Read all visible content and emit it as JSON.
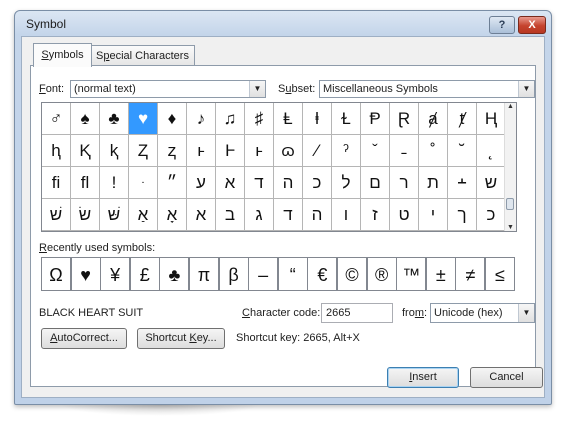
{
  "window": {
    "title": "Symbol",
    "help_label": "?",
    "close_label": "X"
  },
  "tabs": [
    {
      "label": "Symbols",
      "mnemonic": "S",
      "rest": "ymbols"
    },
    {
      "label": "Special Characters",
      "pre": "S",
      "mnemonic": "p",
      "rest": "ecial Characters"
    }
  ],
  "font": {
    "label_m": "F",
    "label_rest": "ont:",
    "value": "(normal text)"
  },
  "subset": {
    "label_pre": "S",
    "label_m": "u",
    "label_rest": "bset:",
    "value": "Miscellaneous Symbols"
  },
  "symbol_grid": {
    "rows": [
      [
        "♂",
        "♠",
        "♣",
        "♥",
        "♦",
        "♪",
        "♫",
        "♯",
        "Ⱡ",
        "ⱡ",
        "Ɫ",
        "Ᵽ",
        "Ɽ",
        "ⱥ",
        "ⱦ",
        "Ⱨ"
      ],
      [
        "ⱨ",
        "Ⱪ",
        "ⱪ",
        "Ⱬ",
        "ⱬ",
        "ⱶ",
        "Ⱶ",
        "ⱶ",
        "ɷ",
        "⁄",
        "ˀ",
        "ˇ",
        "˗",
        "˚",
        "˘",
        "˛"
      ],
      [
        "ﬁ",
        "ﬂ",
        "!",
        "ּ",
        "״",
        "ע",
        "א",
        "ד",
        "ה",
        "כ",
        "ל",
        "ם",
        "ר",
        "ת",
        "﬩",
        "ש"
      ],
      [
        "שׁ",
        "שׂ",
        "שּׁ",
        "אַ",
        "אָ",
        "א",
        "ב",
        "ג",
        "ד",
        "ה",
        "ו",
        "ז",
        "ט",
        "י",
        "ך",
        "כ"
      ]
    ],
    "selected": {
      "row": 0,
      "col": 3
    }
  },
  "recent": {
    "label_m": "R",
    "label_rest": "ecently used symbols:",
    "items": [
      "Ω",
      "♥",
      "¥",
      "£",
      "♣",
      "π",
      "β",
      "–",
      "“",
      "€",
      "©",
      "®",
      "™",
      "±",
      "≠",
      "≤"
    ]
  },
  "char_info": {
    "name": "BLACK HEART SUIT",
    "code_label_m": "C",
    "code_label_rest": "haracter code:",
    "code_value": "2665",
    "from_label_pre": "fro",
    "from_label_m": "m",
    "from_label_rest": ":",
    "from_value": "Unicode (hex)"
  },
  "buttons": {
    "autocorrect_m": "A",
    "autocorrect_rest": "utoCorrect...",
    "shortcut_pre": "Shortcut ",
    "shortcut_m": "K",
    "shortcut_rest": "ey...",
    "insert_m": "I",
    "insert_rest": "nsert",
    "cancel": "Cancel"
  },
  "shortcut_key_text": "Shortcut key: 2665, Alt+X",
  "colors": {
    "selection": "#3399ff",
    "title_gradient": "#c4d5ea",
    "close_button": "#c5432e"
  }
}
